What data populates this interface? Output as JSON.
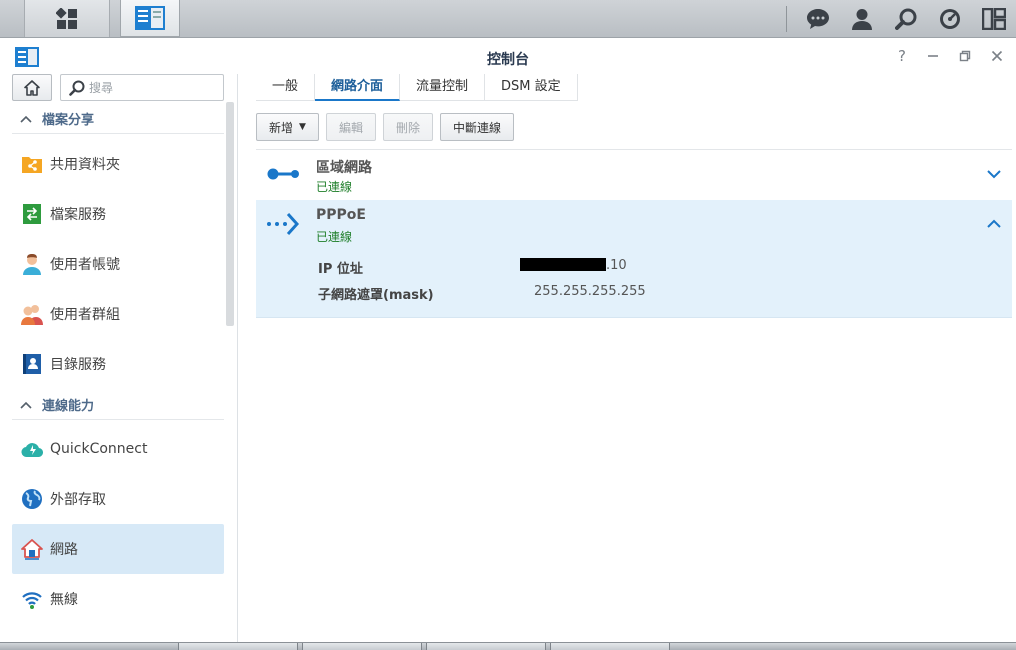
{
  "window": {
    "title": "控制台"
  },
  "search": {
    "placeholder": "搜尋"
  },
  "sidebar": {
    "sections": [
      {
        "label": "檔案分享"
      },
      {
        "label": "連線能力"
      }
    ],
    "items": [
      {
        "label": "共用資料夾",
        "icon": "shared-folder-icon"
      },
      {
        "label": "檔案服務",
        "icon": "file-services-icon"
      },
      {
        "label": "使用者帳號",
        "icon": "user-icon"
      },
      {
        "label": "使用者群組",
        "icon": "group-icon"
      },
      {
        "label": "目錄服務",
        "icon": "directory-icon"
      },
      {
        "label": "QuickConnect",
        "icon": "quickconnect-icon"
      },
      {
        "label": "外部存取",
        "icon": "globe-icon"
      },
      {
        "label": "網路",
        "icon": "network-house-icon",
        "active": true
      },
      {
        "label": "無線",
        "icon": "wifi-icon"
      }
    ]
  },
  "tabs": [
    {
      "label": "一般"
    },
    {
      "label": "網路介面",
      "active": true
    },
    {
      "label": "流量控制"
    },
    {
      "label": "DSM 設定"
    }
  ],
  "toolbar": {
    "create_label": "新增",
    "edit_label": "編輯",
    "delete_label": "刪除",
    "disconnect_label": "中斷連線"
  },
  "interfaces": [
    {
      "name": "區域網路",
      "status": "已連線",
      "expanded": false
    },
    {
      "name": "PPPoE",
      "status": "已連線",
      "expanded": true,
      "details": [
        {
          "label": "IP 位址",
          "value": ".10",
          "redacted_prefix": true
        },
        {
          "label": "子網路遮罩(mask)",
          "value": "255.255.255.255"
        }
      ]
    }
  ],
  "colors": {
    "accent": "#1a77c9",
    "connected": "#1f7f2a",
    "active_bg": "#d7e9f7"
  }
}
